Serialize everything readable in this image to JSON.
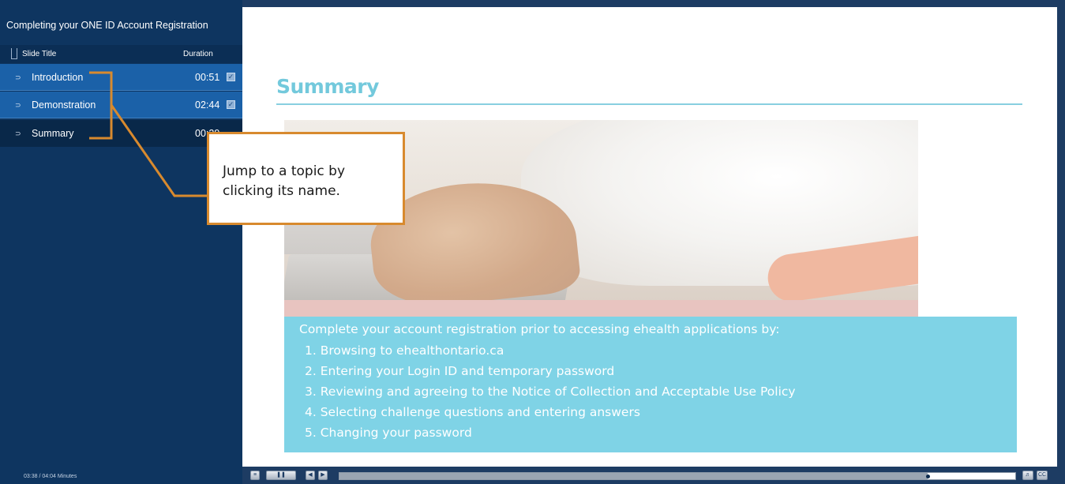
{
  "sidebar": {
    "course_title": "Completing your ONE ID Account Registration",
    "header_title": "Slide Title",
    "header_duration": "Duration",
    "items": [
      {
        "label": "Introduction",
        "duration": "00:51"
      },
      {
        "label": "Demonstration",
        "duration": "02:44"
      },
      {
        "label": "Summary",
        "duration": "00:29"
      }
    ],
    "time_readout": "03:38 / 04:04 Minutes"
  },
  "slide": {
    "title": "Summary",
    "intro": "Complete your account registration prior to accessing ehealth applications by:",
    "steps": [
      "1.  Browsing to ehealthontario.ca",
      "2.  Entering your Login ID and temporary password",
      "3.  Reviewing and agreeing to the Notice of Collection and Acceptable Use Policy",
      "4.  Selecting challenge questions and entering answers",
      "5.  Changing your password"
    ]
  },
  "callout": {
    "text_line1": "Jump to a topic by",
    "text_line2": "clicking its name."
  },
  "controls": {
    "menu_icon": "menu-icon",
    "play_pause_icon": "pause-icon",
    "prev_icon": "previous-icon",
    "next_icon": "next-icon",
    "volume_icon": "volume-icon",
    "cc_label": "CC",
    "progress": 0.87
  },
  "colors": {
    "sidebar_bg": "#0e3560",
    "row_done": "#1b61a8",
    "row_current": "#092849",
    "accent": "#73c9dc",
    "summary_box": "#7fd3e6",
    "callout_border": "#d88a2e"
  }
}
